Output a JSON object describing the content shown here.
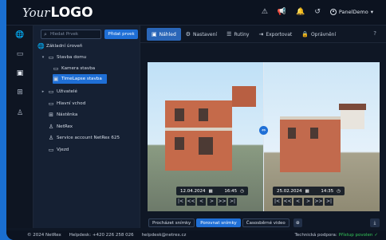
{
  "logo": {
    "prefix": "Your",
    "brand": "LOGO"
  },
  "topbar": {
    "icons": [
      "warning-icon",
      "megaphone-icon",
      "bell-icon",
      "history-icon"
    ],
    "user": "PanelDemo",
    "user_caret": "▾"
  },
  "sidebar_rail": [
    "globe-icon",
    "camera-icon",
    "photos-icon",
    "grid-icon",
    "user-icon"
  ],
  "tree": {
    "search_placeholder": "Hledat Prvek",
    "add_button": "Přidat prvek",
    "nodes": [
      {
        "label": "Základní úroveň",
        "icon": "globe-icon"
      },
      {
        "label": "Stavba domu",
        "icon": "folder-icon"
      },
      {
        "label": "Kamera stavba",
        "icon": "camera-icon"
      },
      {
        "label": "TimeLapse stavba",
        "icon": "photos-icon"
      },
      {
        "label": "Uživatelé",
        "icon": "folder-icon"
      },
      {
        "label": "Hlavní vchod",
        "icon": "camera-icon"
      },
      {
        "label": "Nástěnka",
        "icon": "grid-icon"
      },
      {
        "label": "NetRex",
        "icon": "user-icon"
      },
      {
        "label": "Service account NetRex 625",
        "icon": "user-icon"
      },
      {
        "label": "Vjezd",
        "icon": "camera-icon"
      }
    ]
  },
  "tabs": [
    {
      "label": "Náhled",
      "icon": "photos-icon"
    },
    {
      "label": "Nastavení",
      "icon": "gear-icon"
    },
    {
      "label": "Rutiny",
      "icon": "list-icon"
    },
    {
      "label": "Exportovat",
      "icon": "export-icon"
    },
    {
      "label": "Oprávnění",
      "icon": "lock-icon"
    }
  ],
  "viewer": {
    "left": {
      "date": "12.04.2024",
      "time": "16:45"
    },
    "right": {
      "date": "25.02.2024",
      "time": "14:35"
    },
    "nav": [
      "|<",
      "<<",
      "<",
      ">",
      ">>",
      ">|"
    ]
  },
  "bottom_tabs": [
    "Procházet snímky",
    "Porovnat snímky",
    "Časosběrné video"
  ],
  "footer": {
    "copyright": "© 2024 NetRex",
    "helpdesk_phone": "Helpdesk: +420 226 258 026",
    "helpdesk_email": "helpdesk@netrex.cz",
    "support_label": "Technická podpora:",
    "support_status": "Přístup povolen"
  }
}
